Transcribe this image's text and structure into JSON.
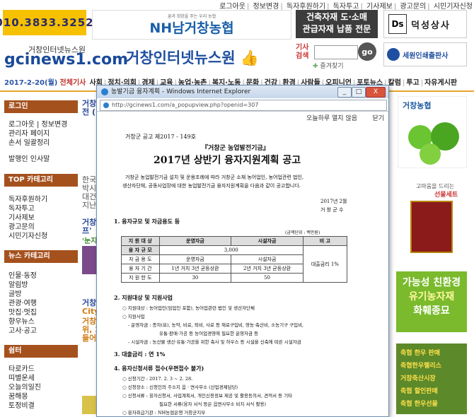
{
  "top_nav": [
    "로그아웃",
    "정보변경",
    "독자후원하기",
    "독자투고",
    "기사제보",
    "광고문의",
    "시민기자신청"
  ],
  "header": {
    "phone": "010.3833.3252",
    "nh_slogan": "꿈과 희망을 주는 우리 농협",
    "nh_logo": "NH남거창농협",
    "building_ad": [
      "건축자재 도·소매",
      "관급자재 납품 전문"
    ],
    "ds_mark": "Ds",
    "ds_name": "덕성상사",
    "site_small": "거창인터넷뉴스원",
    "site_logo": "gcinews1.com",
    "site_title": "거창인터넷뉴스원",
    "search_label": "기사검색",
    "search_button": "go",
    "bookmark": "즐겨찾기",
    "seiwon": "세원인쇄출판사"
  },
  "category_bar": {
    "date": "2017-2-20(월)",
    "label": "전체기사",
    "items": [
      "사회",
      "정치·의회",
      "경제",
      "교육",
      "농업·농촌",
      "복지·노동",
      "문화",
      "건강",
      "환경",
      "사람들",
      "오피니언",
      "포토뉴스",
      "칼럼",
      "투고",
      "자유게시판"
    ]
  },
  "sidebar": {
    "login_head": "로그인",
    "login_items": [
      "로그아웃 | 정보변경",
      "관리자 페이지",
      "손서 일괄정리",
      "발행인 인사말"
    ],
    "top_head": "TOP 카테고리",
    "top_items": [
      "독자후원하기",
      "독자투고",
      "기사제보",
      "광고문의",
      "시민기자신청"
    ],
    "news_head": "뉴스 카테고리",
    "news_items": [
      "인물·동정",
      "알림방",
      "글방",
      "관광·여행",
      "맛집·멋집",
      "향우뉴스",
      "고사·공고"
    ],
    "community_head": "쉼터",
    "community_items": [
      "타로카드",
      "띠별운세",
      "오늘의일진",
      "꿈해몽",
      "토정비결"
    ]
  },
  "middle_peek": [
    "거창",
    "전 (",
    "한국",
    "박시",
    "대건",
    "지난",
    "거창",
    "프'",
    "'눈지",
    "거창",
    "City",
    "거창",
    "위, 3",
    "들어"
  ],
  "right_column": {
    "nh_title": "거창농협",
    "gift_line1": "고마움을 드리는",
    "gift_line2": "선물세트",
    "eco_lines": [
      "가능성 친환경",
      "유기농자재",
      "화훼종묘"
    ],
    "fest_lines": [
      "축협 한우 판매",
      "축협한우팰리스",
      "거창축산시장",
      "축협 할인판매",
      "축협 한우선물"
    ]
  },
  "popup": {
    "title": "농발기금 융자계획 - Windows Internet Explorer",
    "minimize": "_",
    "maximize": "□",
    "close": "X",
    "url": "http://gcinews1.com/a_popupview.php?openid=307",
    "no_show_today": "오늘하루 열지 않음",
    "close_link": "닫기",
    "doc": {
      "notice_no": "거창군 공고 제2017 - 149호",
      "subtitle": "『거창군 농업발전기금』",
      "title": "2017년 상반기 융자지원계획 공고",
      "intro1": "거창군 농업발전기금 설치 및 운용조례에 따라 거창군 소재 농어업인, 농어업관련 법인,",
      "intro2": "생산자단체, 공동사업장에 대한 농업발전기금 융자지원계획을 다음과 같이 공고합니다.",
      "date": "2017년 2월",
      "issuer": "거 창 군 수",
      "sec1": "1. 융자규모 및 자금용도 등",
      "unit": "(금액단위 : 백만원)",
      "table_header": [
        "지 원 대 상",
        "운영자금",
        "시설자금",
        "비 고"
      ],
      "table_rows": [
        [
          "융 자 규 모",
          "3,000",
          "",
          ""
        ],
        [
          "자 금 용 도",
          "운영자금",
          "시설자금",
          "대출금리 1%"
        ],
        [
          "융 자 기 간",
          "1년 거치 3년 균등상환",
          "2년 거치 3년 균등상환",
          ""
        ],
        [
          "지 원 한 도",
          "30",
          "50",
          ""
        ]
      ],
      "sec2": "2. 지원대상 및 지원사업",
      "sec2_a": "○ 지원대상 : 농어업인(임업인 포함), 농어업관련 법인 및 생산자단체",
      "sec2_b": "○ 지원사업",
      "sec2_b1": "- 운영자금 : 종자(묘), 농약, 비료, 퇴비, 사료 등 재료구입비, 영농·축산비, 소농기구 구입비,",
      "sec2_b2": "유통·판매·가공 등 농어업경영에 필요한 운영자금 등",
      "sec2_b3": "- 시설자금 : 농산물 생산·유통·가공을 위한 축사 및 하우스 등 시설을 신축에 따른 시설자금",
      "sec3": "3. 대출금리 : 연 1%",
      "sec4": "4. 융자신청서류 접수(우편접수 불가)",
      "sec4_a": "○ 신청기간 : 2017. 2. 3 ~ 2. 28.",
      "sec4_b": "○ 신청장소 : 신청인의 주소지 읍 · 면사무소 (산업경제담당)",
      "sec4_c": "○ 신청서류 : 융자신청서, 사업계획서, 개인신용정보 제공 및 활용동의서, 견적서 등 기타",
      "sec4_c2": "필요한 서류(융자 서식 등은 읍면사무소 비치 서식 활용)",
      "sec4_d": "○ 융자취급기관 : NH농협은행 거창군지부"
    }
  }
}
